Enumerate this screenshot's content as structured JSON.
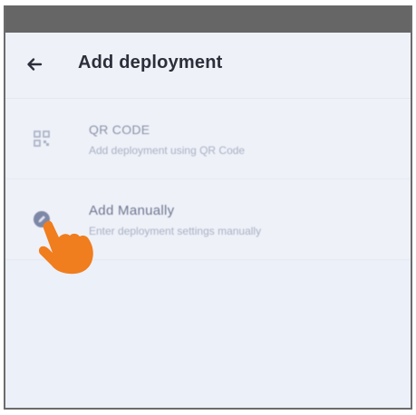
{
  "header": {
    "back_icon": "arrow-left-icon",
    "title": "Add deployment"
  },
  "options": [
    {
      "icon": "qr-code-icon",
      "title": "QR CODE",
      "subtitle": "Add deployment using QR Code"
    },
    {
      "icon": "edit-circle-icon",
      "title": "Add Manually",
      "subtitle": "Enter deployment settings manually"
    }
  ],
  "overlay": {
    "icon": "pointing-hand-icon",
    "color": "#f07d1e"
  },
  "colors": {
    "background": "#ecf0f8",
    "status_bar": "#666666",
    "title_text": "#2c2f3a"
  }
}
